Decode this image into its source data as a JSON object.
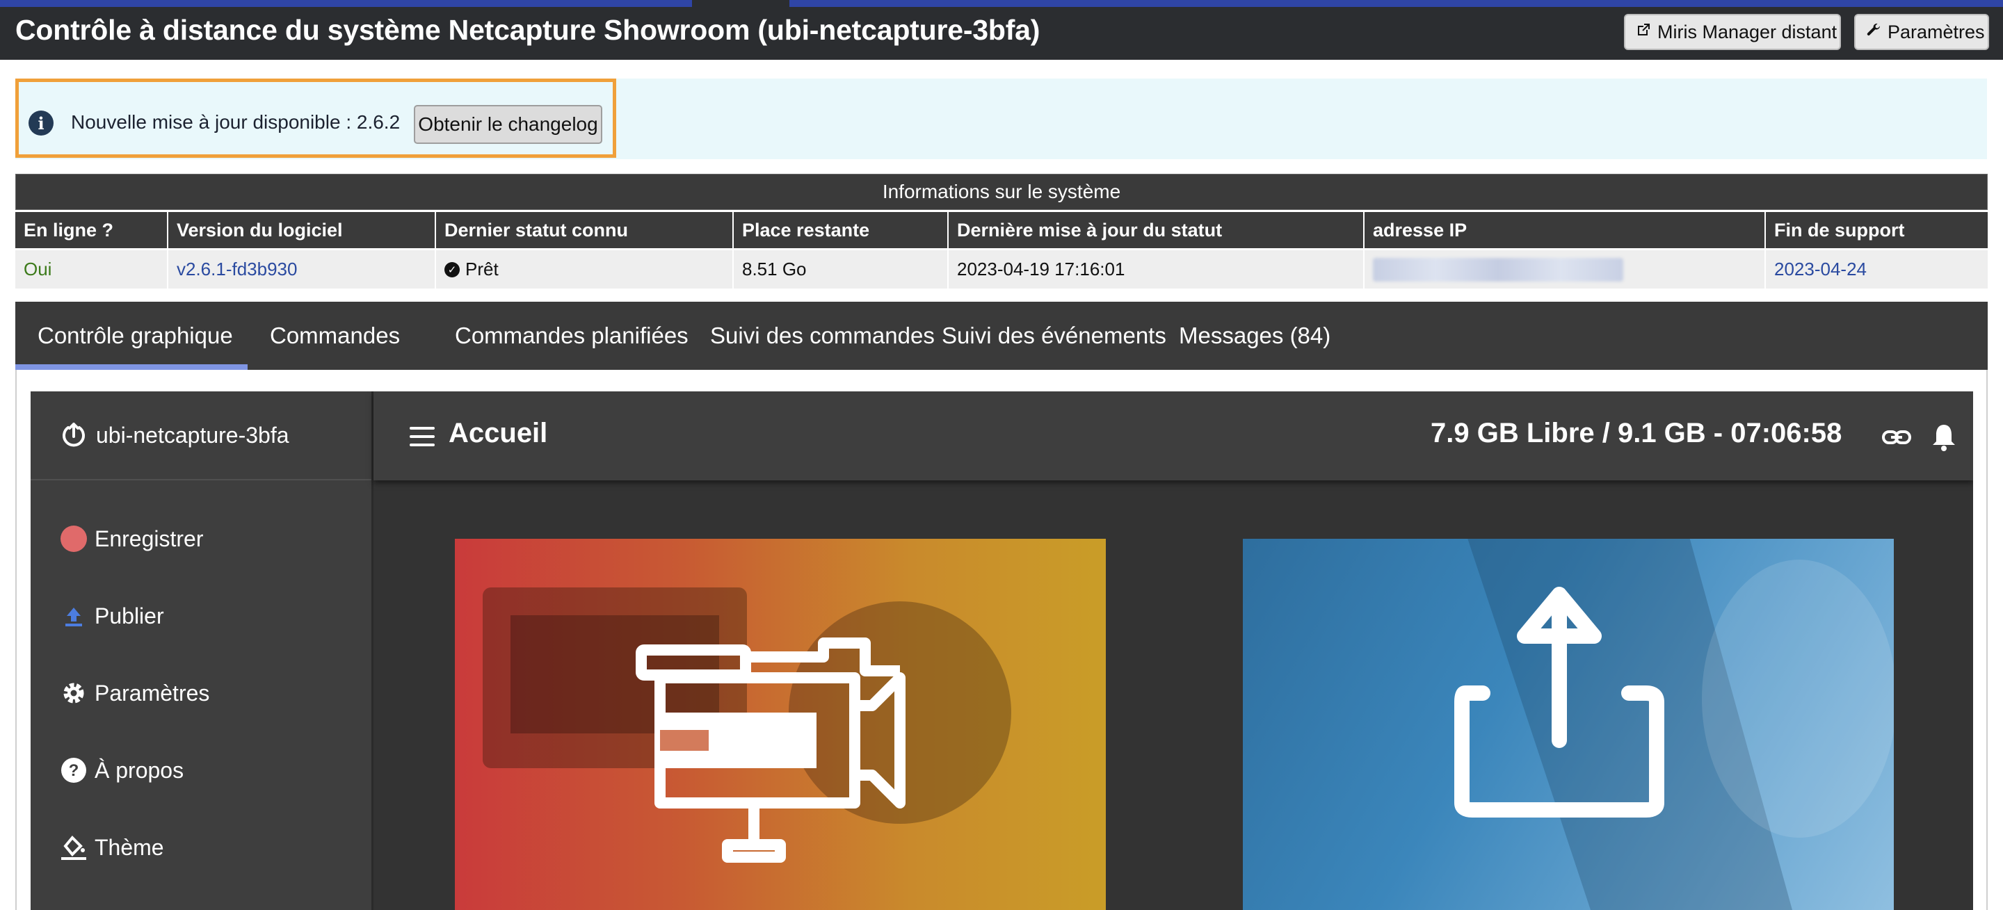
{
  "header": {
    "title": "Contrôle à distance du système Netcapture Showroom (ubi-netcapture-3bfa)",
    "buttons": [
      {
        "label": "Miris Manager distant",
        "icon": "external-link-icon"
      },
      {
        "label": "Paramètres",
        "icon": "wrench-icon"
      }
    ]
  },
  "banner": {
    "icon": "info-icon",
    "message": "Nouvelle mise à jour disponible : 2.6.2",
    "button_label": "Obtenir le changelog"
  },
  "system_info": {
    "title": "Informations sur le système",
    "columns": [
      "En ligne ?",
      "Version du logiciel",
      "Dernier statut connu",
      "Place restante",
      "Dernière mise à jour du statut",
      "adresse IP",
      "Fin de support"
    ],
    "row": {
      "online": "Oui",
      "version": "v2.6.1-fd3b930",
      "status": "Prêt",
      "space": "8.51 Go",
      "last_update": "2023-04-19 17:16:01",
      "ip": "",
      "end_support": "2023-04-24"
    },
    "colors": {
      "online": "#3c7a1a",
      "link": "#2a4aa0"
    }
  },
  "tabs": [
    {
      "label": "Contrôle graphique",
      "active": true
    },
    {
      "label": "Commandes",
      "active": false
    },
    {
      "label": "Commandes planifiées",
      "active": false
    },
    {
      "label": "Suivi des commandes",
      "active": false
    },
    {
      "label": "Suivi des événements",
      "active": false
    },
    {
      "label": "Messages (84)",
      "active": false
    }
  ],
  "device_ui": {
    "brand": "ubi-netcapture-3bfa",
    "nav": [
      {
        "label": "Enregistrer",
        "icon": "record-dot-icon"
      },
      {
        "label": "Publier",
        "icon": "upload-icon"
      },
      {
        "label": "Paramètres",
        "icon": "gear-icon"
      },
      {
        "label": "À propos",
        "icon": "help-circle-icon"
      },
      {
        "label": "Thème",
        "icon": "paint-bucket-icon"
      }
    ],
    "page_title": "Accueil",
    "storage_text": "7.9 GB Libre / 9.1 GB - 07:06:58",
    "tiles": [
      {
        "name": "record-tile",
        "icon": "video-camera-icon"
      },
      {
        "name": "publish-tile",
        "icon": "share-upload-icon"
      }
    ]
  },
  "colors": {
    "header_bg": "#2b2d30",
    "accent_blue": "#2f45a6",
    "banner_bg": "#e9f8fb",
    "highlight_orange": "#f0a03a",
    "active_tab_underline": "#7f95e3",
    "record_dot": "#e06a6a",
    "upload_blue": "#4c7de0"
  }
}
